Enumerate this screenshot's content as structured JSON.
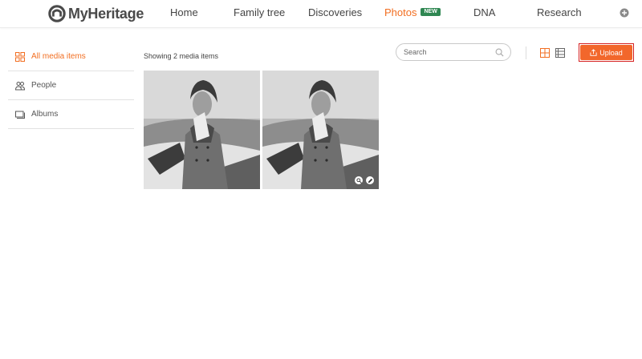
{
  "brand": {
    "name": "MyHeritage"
  },
  "nav": {
    "items": [
      {
        "label": "Home"
      },
      {
        "label": "Family tree"
      },
      {
        "label": "Discoveries"
      },
      {
        "label": "Photos",
        "badge": "NEW",
        "active": true
      },
      {
        "label": "DNA"
      },
      {
        "label": "Research"
      }
    ]
  },
  "sidebar": {
    "items": [
      {
        "label": "All media items",
        "icon": "grid-icon",
        "active": true
      },
      {
        "label": "People",
        "icon": "people-icon"
      },
      {
        "label": "Albums",
        "icon": "albums-icon"
      }
    ]
  },
  "content": {
    "count_text": "Showing 2 media items",
    "search_placeholder": "Search",
    "upload_label": "Upload",
    "photos": [
      {
        "description": "black and white portrait of a woman in a coat holding a book, seated in a convertible car"
      },
      {
        "description": "black and white portrait of a woman in a coat holding a book, seated in a convertible car",
        "hover_actions": [
          "zoom-icon",
          "edit-icon"
        ]
      }
    ]
  },
  "colors": {
    "accent": "#f26e21",
    "upload_button": "#f2672b",
    "badge": "#2f8752",
    "focus_outline": "#d62020"
  }
}
